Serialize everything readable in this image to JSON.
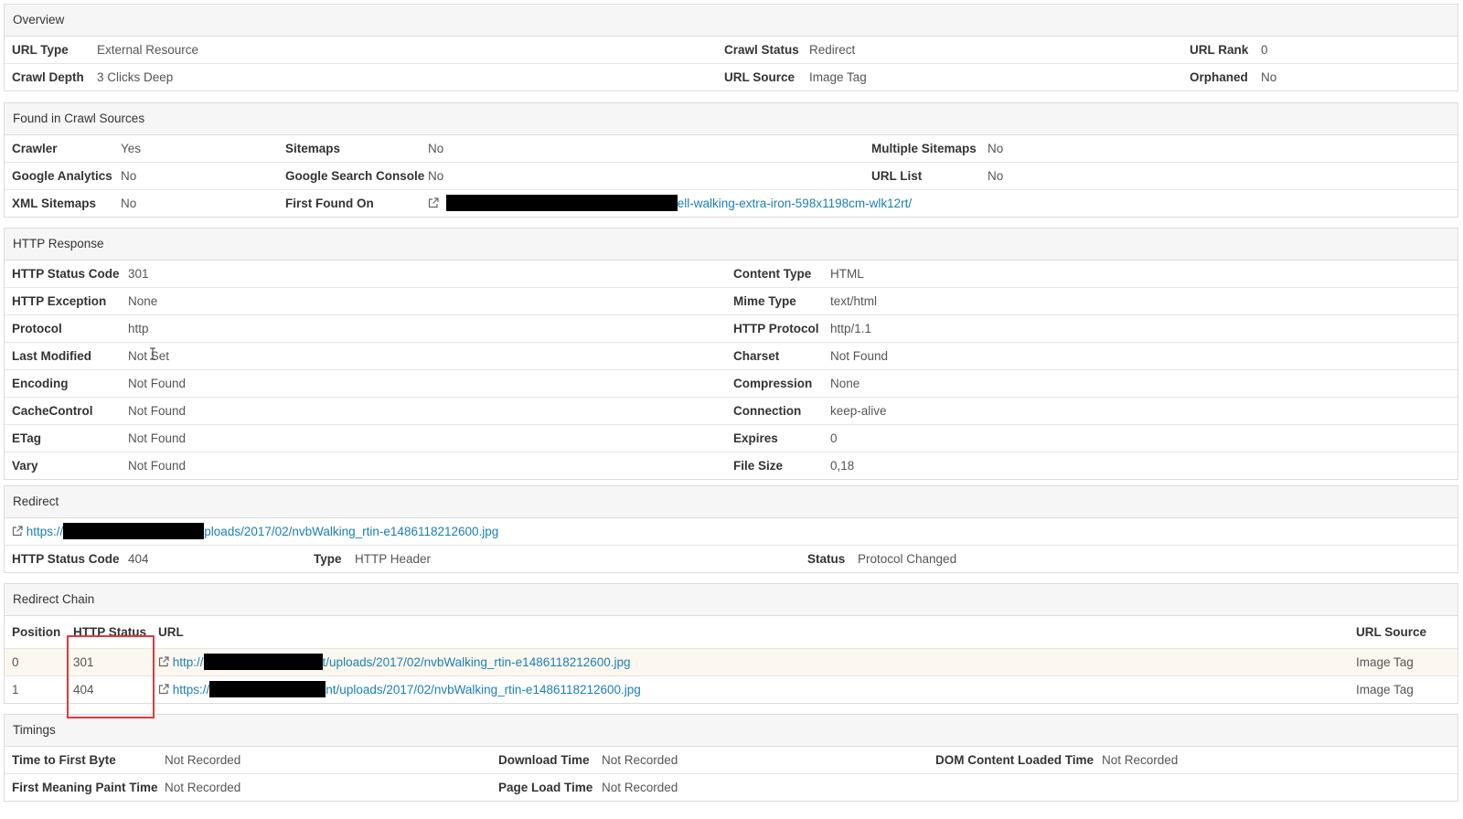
{
  "overview": {
    "title": "Overview",
    "url_type_label": "URL Type",
    "url_type": "External Resource",
    "crawl_status_label": "Crawl Status",
    "crawl_status": "Redirect",
    "url_rank_label": "URL Rank",
    "url_rank": "0",
    "crawl_depth_label": "Crawl Depth",
    "crawl_depth": "3 Clicks Deep",
    "url_source_label": "URL Source",
    "url_source": "Image Tag",
    "orphaned_label": "Orphaned",
    "orphaned": "No"
  },
  "sources": {
    "title": "Found in Crawl Sources",
    "crawler_label": "Crawler",
    "crawler": "Yes",
    "sitemaps_label": "Sitemaps",
    "sitemaps": "No",
    "multiple_sitemaps_label": "Multiple Sitemaps",
    "multiple_sitemaps": "No",
    "ga_label": "Google Analytics",
    "ga": "No",
    "gsc_label": "Google Search Console",
    "gsc": "No",
    "url_list_label": "URL List",
    "url_list": "No",
    "xml_label": "XML Sitemaps",
    "xml": "No",
    "first_found_label": "First Found On",
    "first_found_url": "ell-walking-extra-iron-598x1198cm-wlk12rt/"
  },
  "http": {
    "title": "HTTP Response",
    "rows": [
      {
        "l1": "HTTP Status Code",
        "v1": "301",
        "l2": "Content Type",
        "v2": "HTML"
      },
      {
        "l1": "HTTP Exception",
        "v1": "None",
        "l2": "Mime Type",
        "v2": "text/html"
      },
      {
        "l1": "Protocol",
        "v1": "http",
        "l2": "HTTP Protocol",
        "v2": "http/1.1"
      },
      {
        "l1": "Last Modified",
        "v1": "Not Set",
        "l2": "Charset",
        "v2": "Not Found"
      },
      {
        "l1": "Encoding",
        "v1": "Not Found",
        "l2": "Compression",
        "v2": "None"
      },
      {
        "l1": "CacheControl",
        "v1": "Not Found",
        "l2": "Connection",
        "v2": "keep-alive"
      },
      {
        "l1": "ETag",
        "v1": "Not Found",
        "l2": "Expires",
        "v2": "0"
      },
      {
        "l1": "Vary",
        "v1": "Not Found",
        "l2": "File Size",
        "v2": "0,18"
      }
    ]
  },
  "redirect": {
    "title": "Redirect",
    "url_prefix": "https://",
    "url_suffix": "ploads/2017/02/nvbWalking_rtin-e1486118212600.jpg",
    "status_code_label": "HTTP Status Code",
    "status_code": "404",
    "type_label": "Type",
    "type": "HTTP Header",
    "status_label": "Status",
    "status": "Protocol Changed"
  },
  "chain": {
    "title": "Redirect Chain",
    "headers": {
      "position": "Position",
      "http_status": "HTTP Status",
      "url": "URL",
      "url_source": "URL Source"
    },
    "rows": [
      {
        "position": "0",
        "status": "301",
        "url_prefix": "http://",
        "url_suffix": "t/uploads/2017/02/nvbWalking_rtin-e1486118212600.jpg",
        "source": "Image Tag"
      },
      {
        "position": "1",
        "status": "404",
        "url_prefix": "https://",
        "url_suffix": "nt/uploads/2017/02/nvbWalking_rtin-e1486118212600.jpg",
        "source": "Image Tag"
      }
    ]
  },
  "timings": {
    "title": "Timings",
    "ttfb_label": "Time to First Byte",
    "ttfb": "Not Recorded",
    "download_label": "Download Time",
    "download": "Not Recorded",
    "dcl_label": "DOM Content Loaded Time",
    "dcl": "Not Recorded",
    "fmp_label": "First Meaning Paint Time",
    "fmp": "Not Recorded",
    "load_label": "Page Load Time",
    "load": "Not Recorded"
  },
  "colors": {
    "link": "#1a7fb5",
    "highlight_border": "#e03a3a",
    "row_highlight": "#fdf8ef"
  }
}
